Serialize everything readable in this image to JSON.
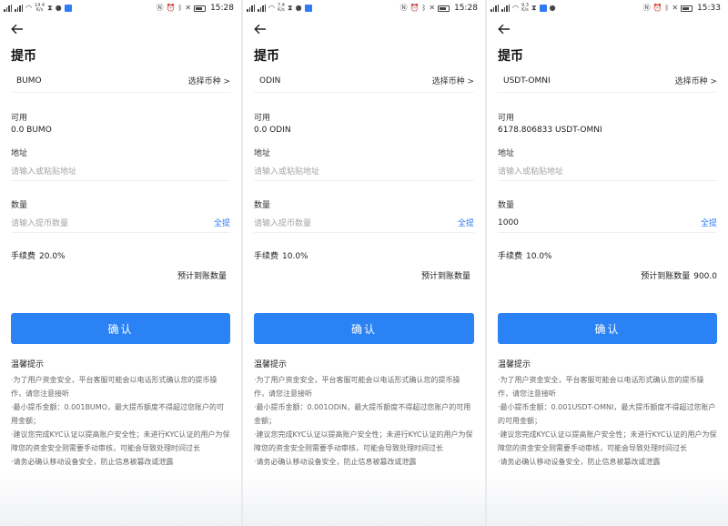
{
  "colors": {
    "primary": "#2b82f5",
    "link": "#2b7cf2",
    "placeholder": "#a5a5a5"
  },
  "icons": {
    "back": "arrow-left-icon",
    "chevron": "chevron-right-icon"
  },
  "shared": {
    "title": "提币",
    "select_coin": "选择币种 >",
    "available_label": "可用",
    "address_label": "地址",
    "address_placeholder": "请输入或粘贴地址",
    "amount_label": "数量",
    "amount_placeholder": "请输入提币数量",
    "all_button": "全提",
    "fee_label": "手续费",
    "arrival_label": "预计到账数量",
    "confirm_button": "确认",
    "tips_title": "温馨提示"
  },
  "screens": [
    {
      "status": {
        "speed_top": "14.4",
        "speed_bottom": "K/s",
        "time": "15:28"
      },
      "coin": "BUMO",
      "available": "0.0 BUMO",
      "amount_value": "",
      "fee": "20.0%",
      "arrival_amount": "",
      "tips": [
        "·为了用户资金安全，平台客服可能会以电话形式确认您的提币操作，请您注意接听",
        "·最小提币金额：0.001BUMO，最大提币额度不得超过您账户的可用金额；",
        "·建议您完成KYC认证以提高账户安全性；未进行KYC认证的用户为保障您的资金安全则需要手动审核，可能会导致处理时间过长",
        "·请务必确认移动设备安全，防止信息被篡改或泄露"
      ]
    },
    {
      "status": {
        "speed_top": "7.4",
        "speed_bottom": "K/s",
        "time": "15:28"
      },
      "coin": "ODIN",
      "available": "0.0 ODIN",
      "amount_value": "",
      "fee": "10.0%",
      "arrival_amount": "",
      "tips": [
        "·为了用户资金安全，平台客服可能会以电话形式确认您的提币操作，请您注意接听",
        "·最小提币金额：0.001ODIN，最大提币额度不得超过您账户的可用金额；",
        "·建议您完成KYC认证以提高账户安全性；未进行KYC认证的用户为保障您的资金安全则需要手动审核，可能会导致处理时间过长",
        "·请务必确认移动设备安全，防止信息被篡改或泄露"
      ]
    },
    {
      "status": {
        "speed_top": "9.3",
        "speed_bottom": "K/s",
        "time": "15:33"
      },
      "coin": "USDT-OMNI",
      "available": "6178.806833 USDT-OMNI",
      "amount_value": "1000",
      "fee": "10.0%",
      "arrival_amount": "900.0",
      "tips": [
        "·为了用户资金安全，平台客服可能会以电话形式确认您的提币操作，请您注意接听",
        "·最小提币金额：0.001USDT-OMNI，最大提币额度不得超过您账户的可用金额；",
        "·建议您完成KYC认证以提高账户安全性；未进行KYC认证的用户为保障您的资金安全则需要手动审核，可能会导致处理时间过长",
        "·请务必确认移动设备安全，防止信息被篡改或泄露"
      ]
    }
  ]
}
